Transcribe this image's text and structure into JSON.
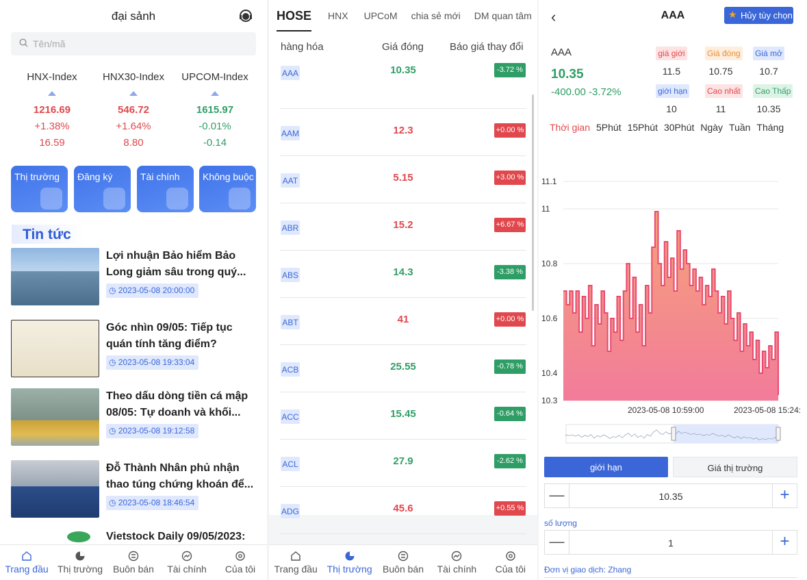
{
  "lobby": {
    "title": "đại sảnh",
    "search_placeholder": "Tên/mã",
    "indices": [
      {
        "name": "HNX-Index",
        "value": "1216.69",
        "change_pct": "+1.38%",
        "change": "16.59",
        "dir": "up"
      },
      {
        "name": "HNX30-Index",
        "value": "546.72",
        "change_pct": "+1.64%",
        "change": "8.80",
        "dir": "up"
      },
      {
        "name": "UPCOM-Index",
        "value": "1615.97",
        "change_pct": "-0.01%",
        "change": "-0.14",
        "dir": "down"
      }
    ],
    "tiles": [
      "Thị trường",
      "Đăng ký",
      "Tài chính",
      "Không buộc"
    ],
    "news_heading": "Tin tức",
    "news": [
      {
        "title": "Lợi nhuận Bảo hiểm Bảo Long giảm sâu trong quý...",
        "time": "2023-05-08 20:00:00"
      },
      {
        "title": "Góc nhìn 09/05: Tiếp tục quán tính tăng điểm?",
        "time": "2023-05-08 19:33:04"
      },
      {
        "title": "Theo dấu dòng tiền cá mập 08/05: Tự doanh và khối...",
        "time": "2023-05-08 19:12:58"
      },
      {
        "title": "Đỗ Thành Nhân phủ nhận thao túng chứng khoán để...",
        "time": "2023-05-08 18:46:54"
      },
      {
        "title": "Vietstock Daily 09/05/2023:",
        "time": ""
      }
    ],
    "tabbar": [
      "Trang đầu",
      "Thị trường",
      "Buôn bán",
      "Tài chính",
      "Của tôi"
    ]
  },
  "market": {
    "tabs": [
      "HOSE",
      "HNX",
      "UPCoM",
      "chia sẻ mới",
      "DM quan tâm"
    ],
    "headers": {
      "symbol": "hàng hóa",
      "price": "Giá đóng",
      "change": "Báo giá thay đổi"
    },
    "rows": [
      {
        "sym": "AAA",
        "price": "10.35",
        "chg": "-3.72 %",
        "dir": "down"
      },
      {
        "sym": "AAM",
        "price": "12.3",
        "chg": "+0.00 %",
        "dir": "up"
      },
      {
        "sym": "AAT",
        "price": "5.15",
        "chg": "+3.00 %",
        "dir": "up"
      },
      {
        "sym": "ABR",
        "price": "15.2",
        "chg": "+6.67 %",
        "dir": "up"
      },
      {
        "sym": "ABS",
        "price": "14.3",
        "chg": "-3.38 %",
        "dir": "down"
      },
      {
        "sym": "ABT",
        "price": "41",
        "chg": "+0.00 %",
        "dir": "up"
      },
      {
        "sym": "ACB",
        "price": "25.55",
        "chg": "-0.78 %",
        "dir": "down"
      },
      {
        "sym": "ACC",
        "price": "15.45",
        "chg": "-0.64 %",
        "dir": "down"
      },
      {
        "sym": "ACL",
        "price": "27.9",
        "chg": "-2.62 %",
        "dir": "down"
      },
      {
        "sym": "ADG",
        "price": "45.6",
        "chg": "+0.55 %",
        "dir": "up"
      }
    ],
    "tabbar": [
      "Trang đầu",
      "Thị trường",
      "Buôn bán",
      "Tài chính",
      "Của tôi"
    ]
  },
  "detail": {
    "symbol": "AAA",
    "fav_label": "Hủy tùy chọn",
    "name": "AAA",
    "price": "10.35",
    "change": "-400.00 -3.72%",
    "stats": [
      {
        "label": "giá giới",
        "value": "11.5",
        "bg": "#fde3e3",
        "fg": "#e0484d"
      },
      {
        "label": "Giá đóng",
        "value": "10.75",
        "bg": "#fdeedd",
        "fg": "#e8903a"
      },
      {
        "label": "Giá mở",
        "value": "10.7",
        "bg": "#dfe8fd",
        "fg": "#3a66d8"
      },
      {
        "label": "giới hạn",
        "value": "10",
        "bg": "#dfe8fd",
        "fg": "#3a66d8"
      },
      {
        "label": "Cao nhất",
        "value": "11",
        "bg": "#fde3e3",
        "fg": "#e0484d"
      },
      {
        "label": "Cao Thấp",
        "value": "10.35",
        "bg": "#ddf3e6",
        "fg": "#2f9e66"
      }
    ],
    "periods": [
      "Thời gian",
      "5Phút",
      "15Phút",
      "30Phút",
      "Ngày",
      "Tuần",
      "Tháng"
    ],
    "order_types": [
      "giới hạn",
      "Giá thị trường"
    ],
    "price_input": "10.35",
    "qty_label": "số lượng",
    "qty_input": "1",
    "unit_label": "Đơn vị giao dịch: Zhang"
  },
  "chart_data": {
    "type": "area",
    "title": "",
    "ylim": [
      10.3,
      11.1
    ],
    "yticks": [
      "11.1",
      "11",
      "10.8",
      "10.6",
      "10.4",
      "10.3"
    ],
    "xticks": [
      "2023-05-08 10:59:00",
      "2023-05-08 15:24:"
    ],
    "x_range": [
      "2023-05-08 10:59:00",
      "2023-05-08 15:24"
    ],
    "values": [
      10.7,
      10.65,
      10.7,
      10.62,
      10.7,
      10.55,
      10.68,
      10.6,
      10.72,
      10.5,
      10.65,
      10.58,
      10.7,
      10.62,
      10.48,
      10.6,
      10.55,
      10.68,
      10.52,
      10.7,
      10.8,
      10.6,
      10.75,
      10.55,
      10.65,
      10.5,
      10.72,
      10.62,
      10.86,
      10.99,
      10.8,
      10.72,
      10.88,
      10.75,
      10.82,
      10.7,
      10.92,
      10.78,
      10.85,
      10.8,
      10.72,
      10.78,
      10.7,
      10.75,
      10.65,
      10.72,
      10.68,
      10.78,
      10.7,
      10.62,
      10.68,
      10.58,
      10.7,
      10.6,
      10.52,
      10.62,
      10.48,
      10.58,
      10.5,
      10.55,
      10.45,
      10.52,
      10.4,
      10.48,
      10.42,
      10.5,
      10.45,
      10.55,
      10.32
    ],
    "color": "#e84a6f"
  }
}
